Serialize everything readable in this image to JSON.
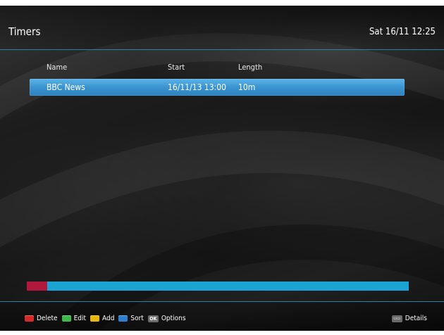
{
  "header": {
    "title": "Timers",
    "datetime": "Sat 16/11 12:25"
  },
  "table": {
    "columns": [
      "Name",
      "Start",
      "Length"
    ],
    "rows": [
      {
        "name": "BBC News",
        "start": "16/11/13 13:00",
        "length": "10m",
        "selected": true
      }
    ]
  },
  "usage_bar": {
    "used_fraction": 0.054,
    "used_color": "#b0193d",
    "free_color": "#1ba3d3"
  },
  "footer": {
    "buttons": [
      {
        "label": "Delete",
        "color": "#d42a2a",
        "icon": "red-key-icon"
      },
      {
        "label": "Edit",
        "color": "#3fb84a",
        "icon": "green-key-icon"
      },
      {
        "label": "Add",
        "color": "#e8b70e",
        "icon": "yellow-key-icon"
      },
      {
        "label": "Sort",
        "color": "#2f7fd0",
        "icon": "blue-key-icon"
      },
      {
        "label": "Options",
        "icon": "ok-key-icon"
      }
    ],
    "ok_icon_text": "OK",
    "details": {
      "label": "Details",
      "icon": "info-key-icon"
    }
  },
  "colors": {
    "accent": "#3b93cf",
    "divider": "#2f7ea8",
    "background": "#1d1d1d"
  }
}
